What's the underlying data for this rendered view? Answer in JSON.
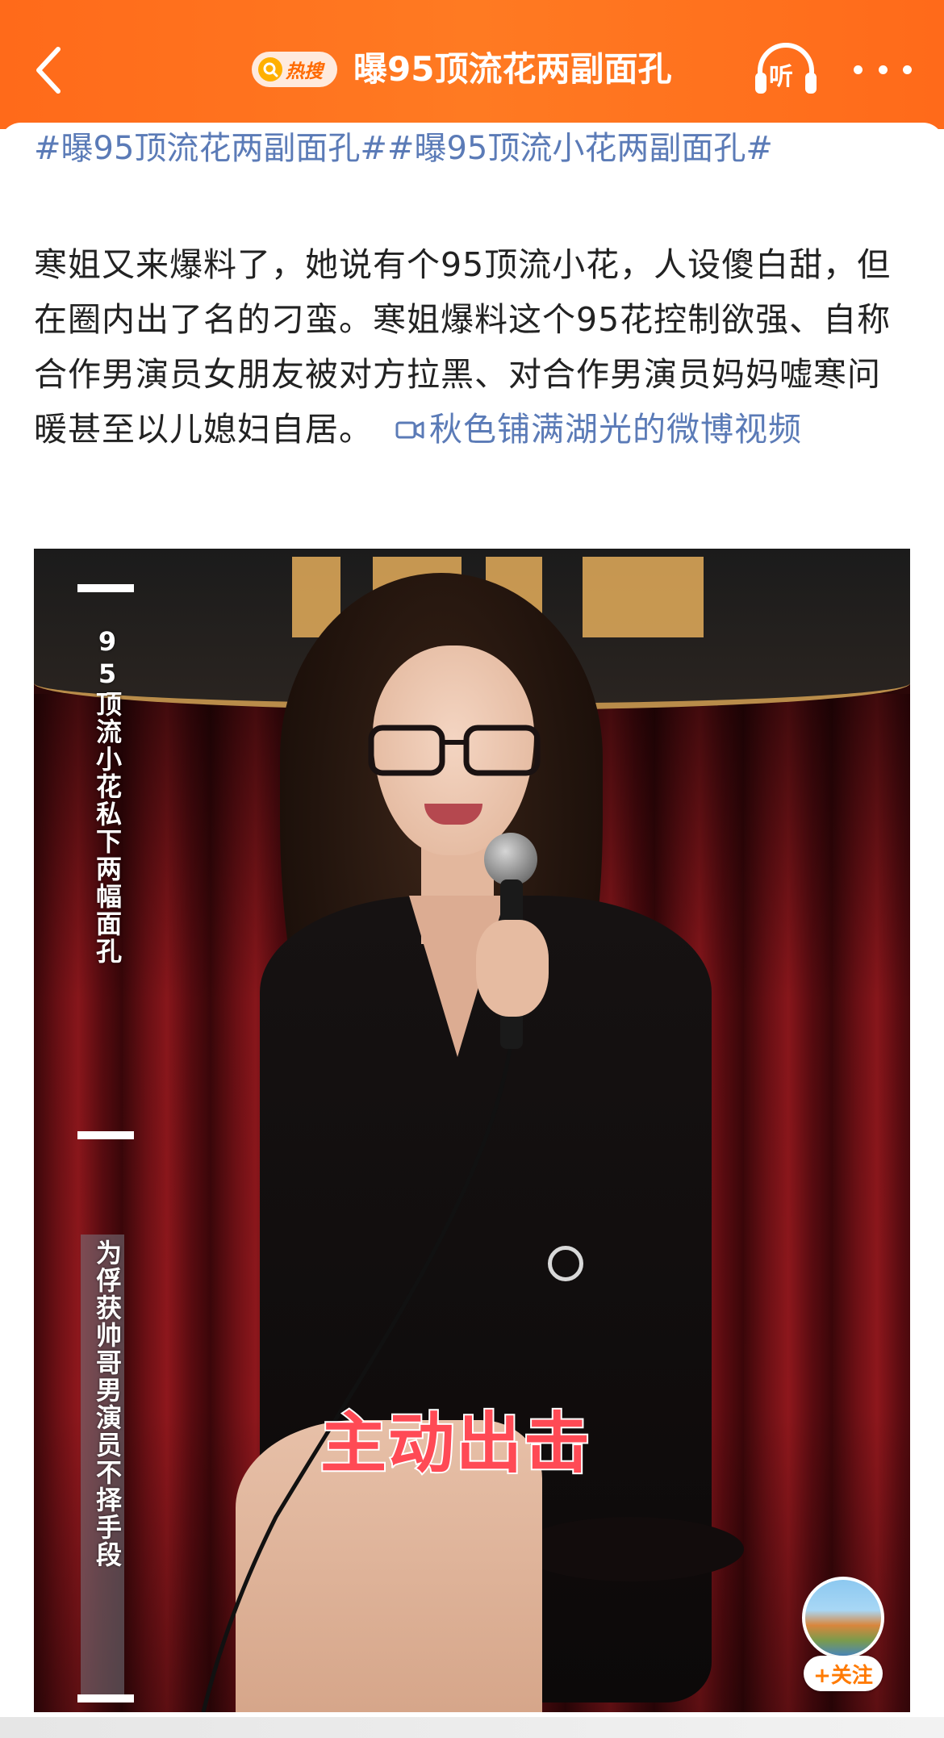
{
  "header": {
    "hot_badge_label": "热搜",
    "title": "曝95顶流花两副面孔",
    "listen_label": "听"
  },
  "post": {
    "topics": "#曝95顶流花两副面孔##曝95顶流小花两副面孔#",
    "body": "寒姐又来爆料了，她说有个95顶流小花，人设傻白甜，但在圈内出了名的刁蛮。寒姐爆料这个95花控制欲强、自称合作男演员女朋友被对方拉黑、对合作男演员妈妈嘘寒问暖甚至以儿媳妇自居。",
    "video_link": "秋色铺满湖光的微博视频"
  },
  "video": {
    "caption_top": "95顶流小花私下两幅面孔",
    "caption_bottom": "为俘获帅哥男演员不择手段",
    "subtitle": "主动出击"
  },
  "follow": {
    "button_label": "+关注"
  },
  "colors": {
    "header_orange": "#ff6a1a",
    "link_blue": "#5b7bb7",
    "subtitle_red": "#ff4a55",
    "follow_orange": "#ff7a00"
  }
}
